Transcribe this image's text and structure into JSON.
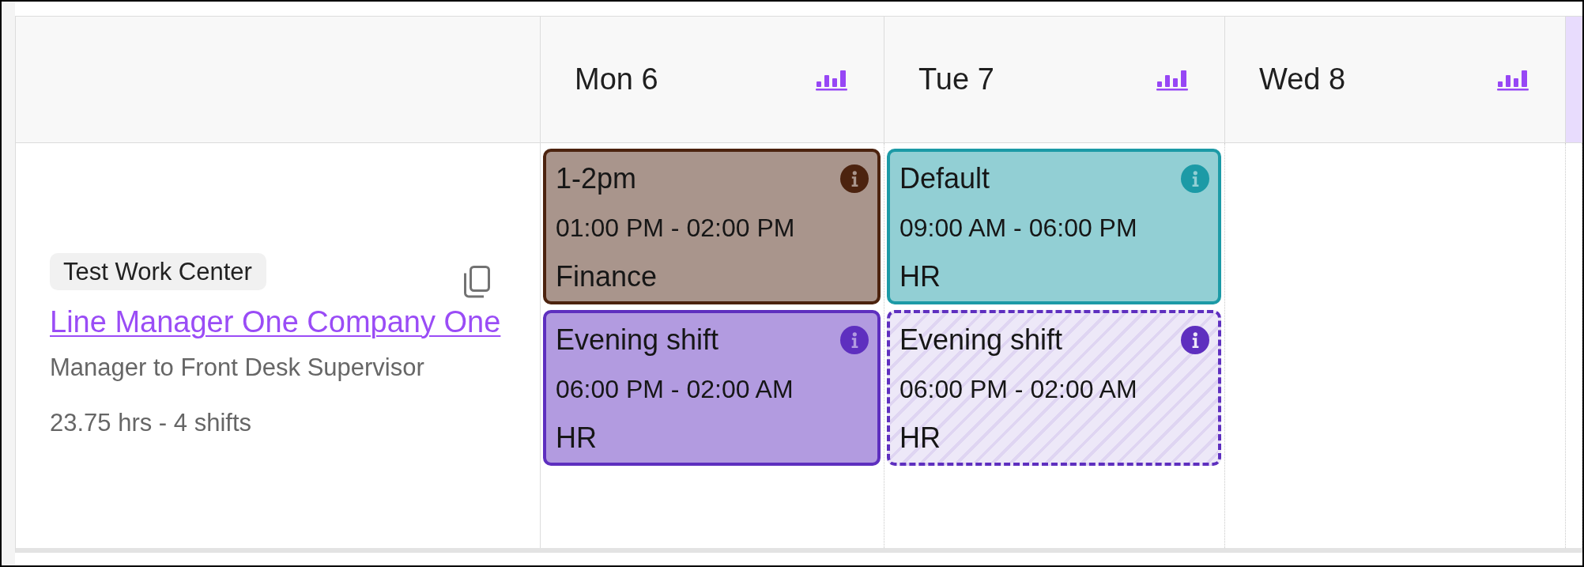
{
  "header": {
    "days": [
      {
        "label": "Mon 6",
        "highlighted": false
      },
      {
        "label": "Tue 7",
        "highlighted": false
      },
      {
        "label": "Wed 8",
        "highlighted": false
      },
      {
        "highlighted": true
      }
    ]
  },
  "rows": [
    {
      "work_center": "Test Work Center",
      "employee": "Line Manager One Company One",
      "position": "Manager to Front Desk Supervisor",
      "summary": "23.75 hrs - 4 shifts",
      "days": [
        {
          "shifts": [
            {
              "title": "1-2pm",
              "time": "01:00 PM - 02:00 PM",
              "department": "Finance",
              "color": "#4c230f",
              "published": true
            },
            {
              "title": "Evening shift",
              "time": "06:00 PM - 02:00 AM",
              "department": "HR",
              "color": "#5e2fbf",
              "published": true
            }
          ]
        },
        {
          "shifts": [
            {
              "title": "Default",
              "time": "09:00 AM - 06:00 PM",
              "department": "HR",
              "color": "#1c9aa6",
              "published": true
            },
            {
              "title": "Evening shift",
              "time": "06:00 PM - 02:00 AM",
              "department": "HR",
              "color": "#5e2fbf",
              "published": false
            }
          ]
        }
      ]
    }
  ]
}
